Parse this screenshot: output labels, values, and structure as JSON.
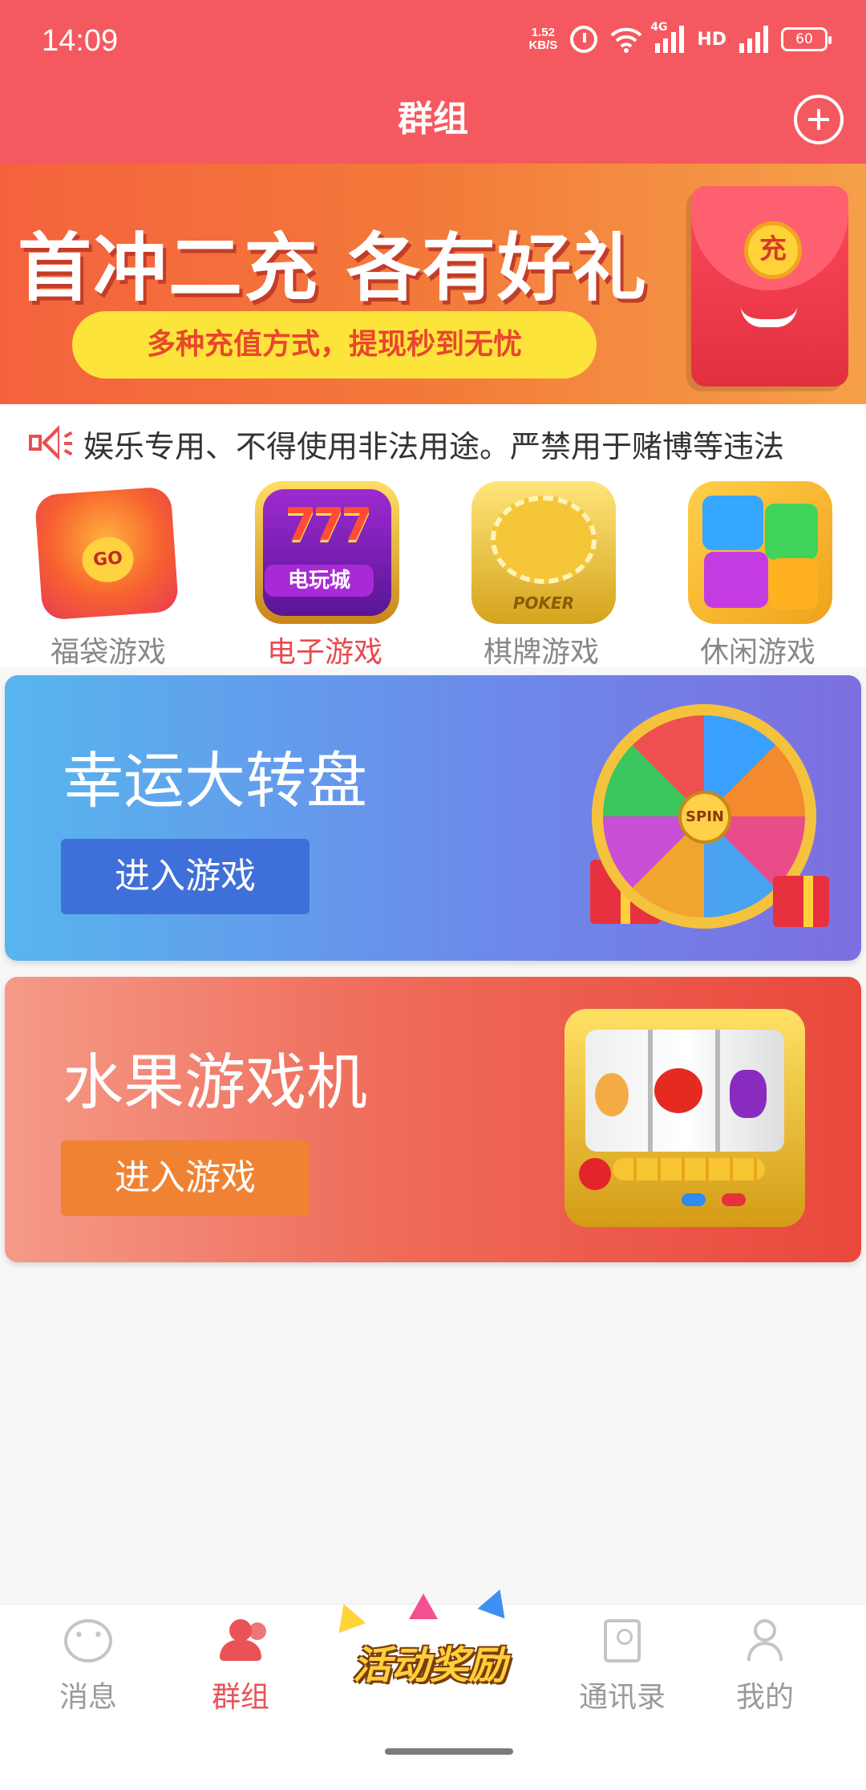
{
  "status_bar": {
    "time": "14:09",
    "net_speed_value": "1.52",
    "net_speed_unit": "KB/S",
    "network_tag": "4G",
    "hd_tag": "HD",
    "battery": "60"
  },
  "header": {
    "title": "群组"
  },
  "banner": {
    "headline": "首冲二充 各有好礼",
    "subline": "多种充值方式，提现秒到无忧",
    "envelope_char": "充",
    "slides": 3,
    "active_slide": 3
  },
  "notice": {
    "text": "娱乐专用、不得使用非法用途。严禁用于赌博等违法"
  },
  "categories": [
    {
      "label": "福袋游戏",
      "active": false,
      "icon": "red-envelope-go-icon",
      "icon_text": "GO"
    },
    {
      "label": "电子游戏",
      "active": true,
      "icon": "slot-777-icon",
      "icon_text": "777",
      "icon_sub": "电玩城"
    },
    {
      "label": "棋牌游戏",
      "active": false,
      "icon": "poker-chip-icon",
      "icon_text": "POKER"
    },
    {
      "label": "休闲游戏",
      "active": false,
      "icon": "gem-blocks-icon"
    }
  ],
  "games": [
    {
      "title": "幸运大转盘",
      "button": "进入游戏",
      "art": "wheel-of-fortune",
      "hub_text": "SPIN"
    },
    {
      "title": "水果游戏机",
      "button": "进入游戏",
      "art": "fruit-slot-machine"
    }
  ],
  "tabbar": {
    "items": [
      {
        "label": "消息",
        "icon": "chat-bubble-icon",
        "active": false
      },
      {
        "label": "群组",
        "icon": "group-icon",
        "active": true
      },
      {
        "label": "活动奖励",
        "icon": "promo-badge",
        "active": false
      },
      {
        "label": "通讯录",
        "icon": "contacts-icon",
        "active": false
      },
      {
        "label": "我的",
        "icon": "profile-icon",
        "active": false
      }
    ]
  },
  "colors": {
    "primary": "#f55960",
    "accent_text": "#e94a4f",
    "card1_gradient_end": "#7d6fe0",
    "card2_gradient_end": "#e9483c"
  }
}
